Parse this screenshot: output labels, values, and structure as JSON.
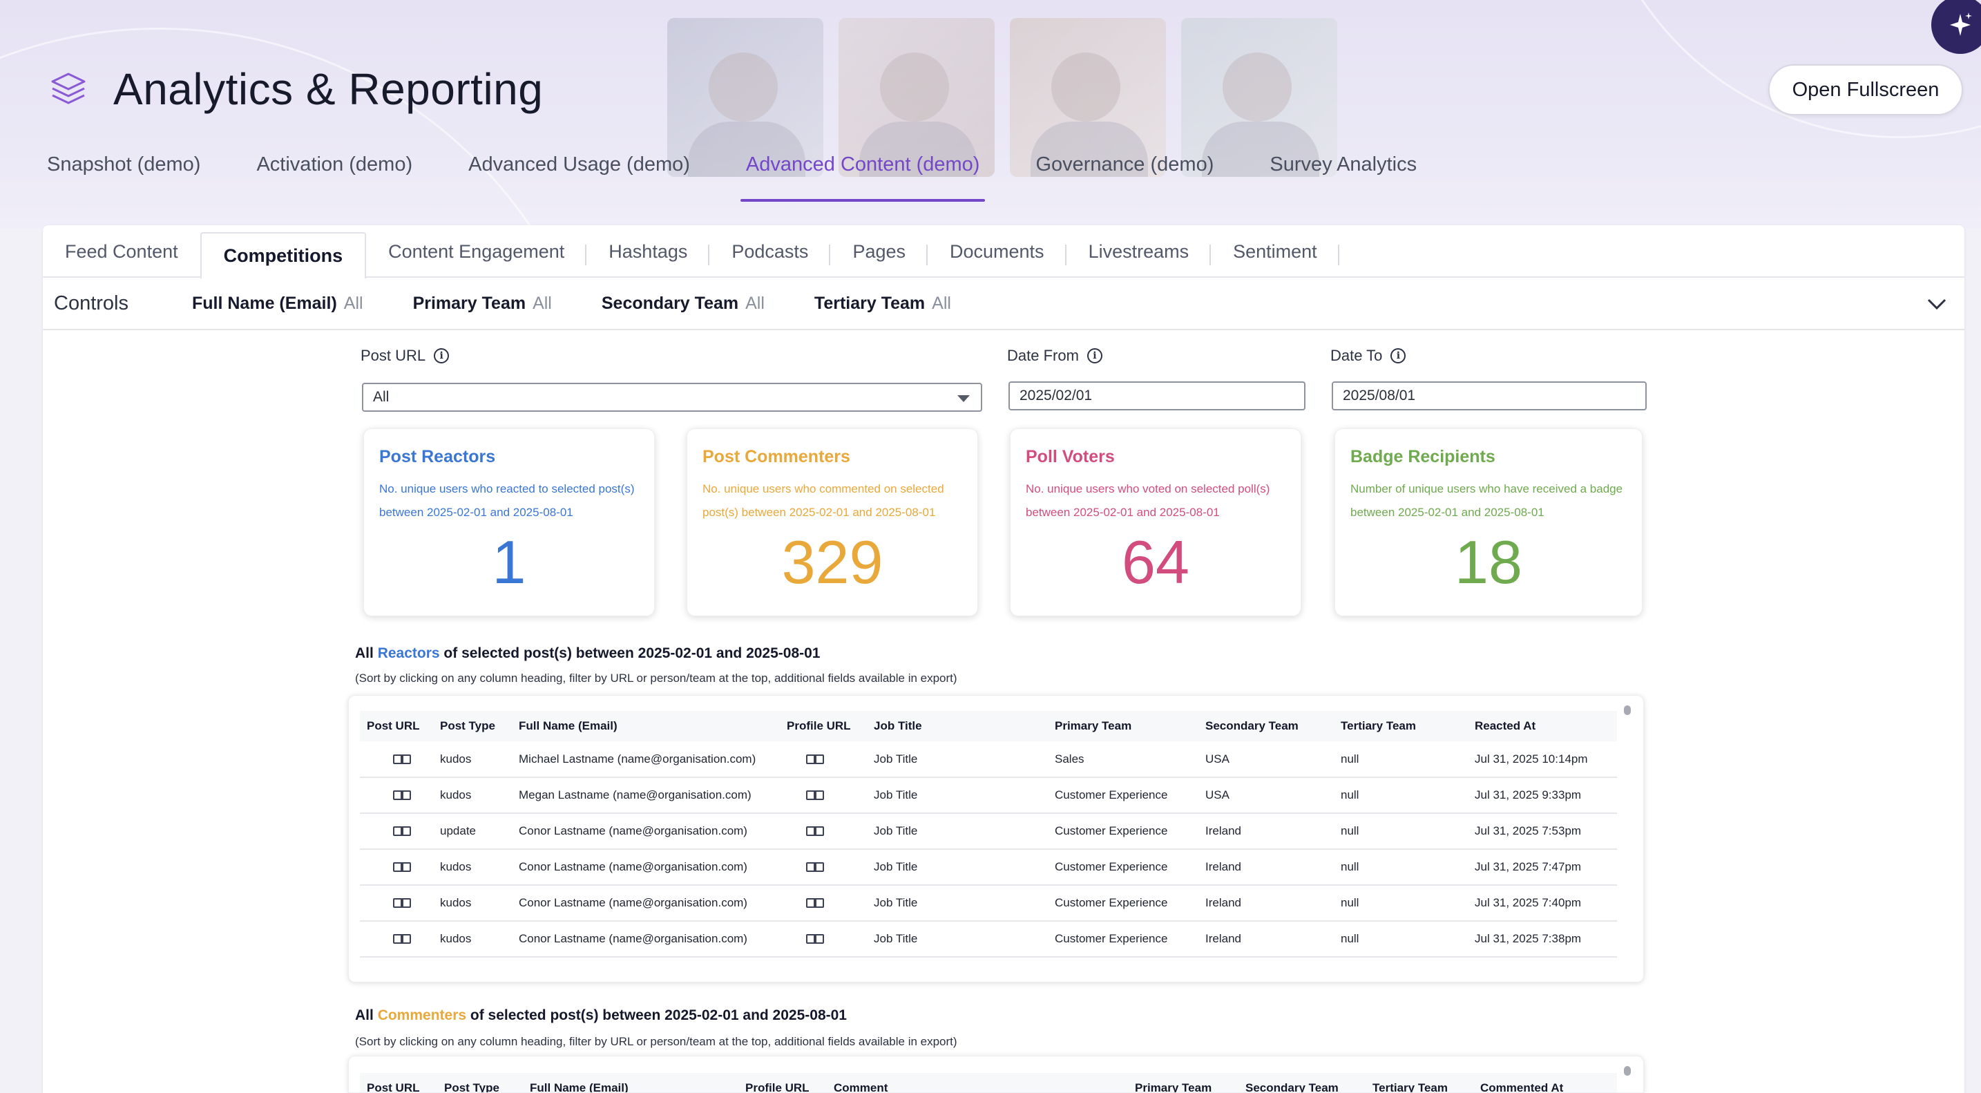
{
  "app": {
    "title": "Analytics & Reporting",
    "fullscreen_label": "Open Fullscreen"
  },
  "main_tabs": [
    {
      "label": "Snapshot (demo)"
    },
    {
      "label": "Activation (demo)"
    },
    {
      "label": "Advanced Usage (demo)"
    },
    {
      "label": "Advanced Content (demo)",
      "active": true
    },
    {
      "label": "Governance (demo)"
    },
    {
      "label": "Survey Analytics"
    }
  ],
  "sub_tabs": [
    {
      "label": "Feed Content"
    },
    {
      "label": "Competitions",
      "active": true
    },
    {
      "label": "Content Engagement"
    },
    {
      "label": "Hashtags"
    },
    {
      "label": "Podcasts"
    },
    {
      "label": "Pages"
    },
    {
      "label": "Documents"
    },
    {
      "label": "Livestreams"
    },
    {
      "label": "Sentiment"
    }
  ],
  "controls": {
    "label": "Controls",
    "filters": [
      {
        "name": "Full Name (Email)",
        "value": "All"
      },
      {
        "name": "Primary Team",
        "value": "All"
      },
      {
        "name": "Secondary Team",
        "value": "All"
      },
      {
        "name": "Tertiary Team",
        "value": "All"
      }
    ]
  },
  "form": {
    "post_url_label": "Post URL",
    "post_url_value": "All",
    "date_from_label": "Date From",
    "date_from_value": "2025/02/01",
    "date_to_label": "Date To",
    "date_to_value": "2025/08/01"
  },
  "cards": [
    {
      "title": "Post Reactors",
      "desc": "No. unique users who reacted to selected post(s) between 2025-02-01 and 2025-08-01",
      "value": "1",
      "color": "#3a76d4"
    },
    {
      "title": "Post Commenters",
      "desc": "No. unique users who commented on selected post(s) between 2025-02-01 and 2025-08-01",
      "value": "329",
      "color": "#e9a83a"
    },
    {
      "title": "Poll Voters",
      "desc": "No. unique users who voted on selected poll(s) between 2025-02-01 and 2025-08-01",
      "value": "64",
      "color": "#d24d7e"
    },
    {
      "title": "Badge Recipients",
      "desc": "Number of unique users who have received a badge between 2025-02-01 and 2025-08-01",
      "value": "18",
      "color": "#6faa4f"
    }
  ],
  "reactors": {
    "title_pre": "All",
    "title_hl": "Reactors",
    "title_post": "of selected post(s) between 2025-02-01 and 2025-08-01",
    "note": "(Sort by clicking on any column heading, filter by URL or person/team at the top, additional fields available in export)",
    "columns": [
      "Post URL",
      "Post Type",
      "Full Name (Email)",
      "Profile URL",
      "Job Title",
      "Primary Team",
      "Secondary Team",
      "Tertiary Team",
      "Reacted At"
    ],
    "rows": [
      {
        "type": "kudos",
        "name": "Michael Lastname (name@organisation.com)",
        "job": "Job Title",
        "primary": "Sales",
        "secondary": "USA",
        "tertiary": "null",
        "at": "Jul 31, 2025 10:14pm"
      },
      {
        "type": "kudos",
        "name": "Megan Lastname (name@organisation.com)",
        "job": "Job Title",
        "primary": "Customer Experience",
        "secondary": "USA",
        "tertiary": "null",
        "at": "Jul 31, 2025 9:33pm"
      },
      {
        "type": "update",
        "name": "Conor Lastname (name@organisation.com)",
        "job": "Job Title",
        "primary": "Customer Experience",
        "secondary": "Ireland",
        "tertiary": "null",
        "at": "Jul 31, 2025 7:53pm"
      },
      {
        "type": "kudos",
        "name": "Conor Lastname (name@organisation.com)",
        "job": "Job Title",
        "primary": "Customer Experience",
        "secondary": "Ireland",
        "tertiary": "null",
        "at": "Jul 31, 2025 7:47pm"
      },
      {
        "type": "kudos",
        "name": "Conor Lastname (name@organisation.com)",
        "job": "Job Title",
        "primary": "Customer Experience",
        "secondary": "Ireland",
        "tertiary": "null",
        "at": "Jul 31, 2025 7:40pm"
      },
      {
        "type": "kudos",
        "name": "Conor Lastname (name@organisation.com)",
        "job": "Job Title",
        "primary": "Customer Experience",
        "secondary": "Ireland",
        "tertiary": "null",
        "at": "Jul 31, 2025 7:38pm"
      }
    ]
  },
  "commenters": {
    "title_pre": "All",
    "title_hl": "Commenters",
    "title_post": "of selected post(s) between 2025-02-01 and 2025-08-01",
    "note": "(Sort by clicking on any column heading, filter by URL or person/team at the top, additional fields available in export)",
    "columns": [
      "Post URL",
      "Post Type",
      "Full Name (Email)",
      "Profile URL",
      "Comment",
      "Primary Team",
      "Secondary Team",
      "Tertiary Team",
      "Commented At"
    ]
  }
}
